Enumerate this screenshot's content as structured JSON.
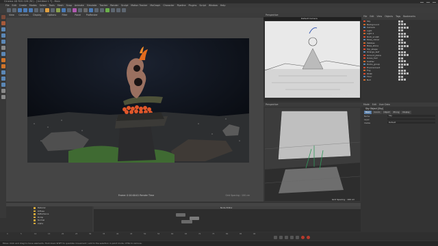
{
  "window": {
    "title": "Cinema 4D R20.026 (RC) - [Untitled 1 *] - Main"
  },
  "menu": [
    "File",
    "Edit",
    "Create",
    "Modes",
    "Select",
    "Tools",
    "Mesh",
    "Snap",
    "Animate",
    "Simulate",
    "Tracker",
    "Render",
    "Sculpt",
    "Motion Tracker",
    "MoGraph",
    "Character",
    "Pipeline",
    "Plugins",
    "Script",
    "Window",
    "Help"
  ],
  "viewport_main": {
    "menu": [
      "View",
      "Cameras",
      "Display",
      "Options",
      "Filter",
      "Panel",
      "ProRender"
    ],
    "label": "Perspective",
    "status": "Frame: 0   00:00:01   Render Time",
    "scale": "Grid Spacing : 100 cm"
  },
  "viewport_top": {
    "title": "Perspective",
    "camera": "Default Camera",
    "grid": "Grid Spacing : 1000 cm"
  },
  "viewport_bottom": {
    "menu": [
      "View",
      "Cameras",
      "Display",
      "Options",
      "Filter",
      "Panel"
    ],
    "title": "Perspective",
    "grid": "Grid Spacing : 100 cm"
  },
  "objects_panel": {
    "tabs": [
      "File",
      "Edit",
      "View",
      "Objects",
      "Tags",
      "Bookmarks"
    ],
    "items": [
      "Sky",
      "Background",
      "Camera",
      "Light",
      "Light.1",
      "Rock_sculpt",
      "Moss_cloner",
      "Pebbles",
      "Base_stone",
      "Top_shape",
      "Orange_leaf",
      "Ground_plane",
      "Grass_hair",
      "Scatter",
      "Rocks_group",
      "Environment",
      "Fog",
      "HDRI",
      "Floor",
      "Null"
    ]
  },
  "attributes_panel": {
    "tabs": [
      "Mode",
      "Edit",
      "User Data"
    ],
    "title": "Sky Object [Sky]",
    "subtabs": [
      "Basic",
      "Coord.",
      "Object",
      "Phong",
      "Display"
    ],
    "fields": [
      {
        "label": "Name",
        "value": "Sky"
      },
      {
        "label": "Layer",
        "value": ""
      },
      {
        "label": "Visible",
        "value": "Default"
      }
    ]
  },
  "node_editor": {
    "title": "Node Editor",
    "list": [
      "Material",
      "Diffuse",
      "Reflectance",
      "Bump",
      "Normal",
      "Alpha"
    ]
  },
  "timeline": {
    "ticks": [
      "0",
      "5",
      "10",
      "15",
      "20",
      "25",
      "30",
      "35",
      "40",
      "45",
      "50",
      "55",
      "60",
      "65",
      "70",
      "75",
      "80",
      "85",
      "90"
    ]
  },
  "status": "Move: Click and drag to move elements. Hold down SHIFT to quantize movement / add to the selection in point mode, CTRL to remove."
}
